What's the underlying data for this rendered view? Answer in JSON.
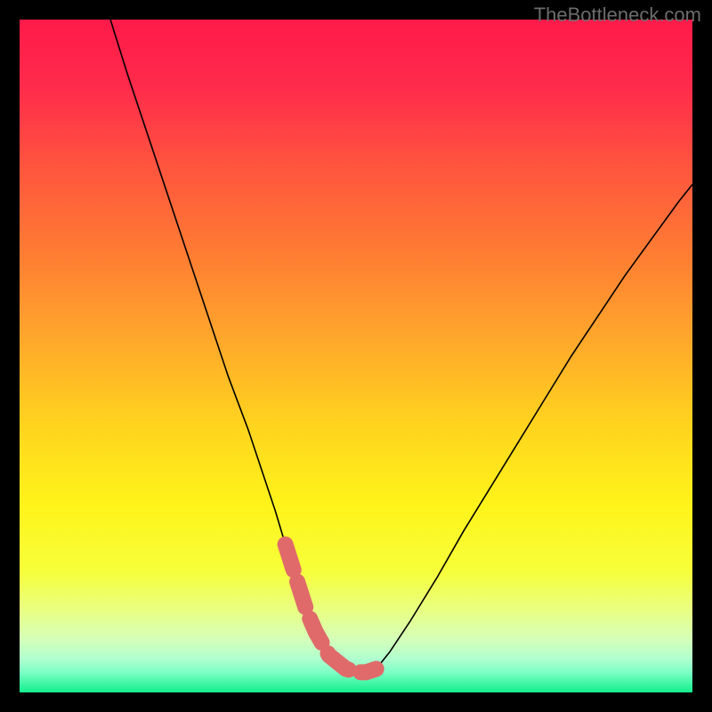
{
  "watermark": "TheBottleneck.com",
  "chart_data": {
    "type": "line",
    "title": "",
    "xlabel": "",
    "ylabel": "",
    "legend": [],
    "x_range": [
      0,
      100
    ],
    "y_range_percent": [
      0,
      100
    ],
    "background_gradient": {
      "stops": [
        {
          "pos": 0.0,
          "color": "#ff1a4a"
        },
        {
          "pos": 0.1,
          "color": "#ff2b4b"
        },
        {
          "pos": 0.22,
          "color": "#ff553e"
        },
        {
          "pos": 0.35,
          "color": "#ff7d33"
        },
        {
          "pos": 0.48,
          "color": "#ffa92b"
        },
        {
          "pos": 0.6,
          "color": "#ffd31e"
        },
        {
          "pos": 0.72,
          "color": "#fff31a"
        },
        {
          "pos": 0.82,
          "color": "#f6ff3a"
        },
        {
          "pos": 0.88,
          "color": "#e8ff85"
        },
        {
          "pos": 0.92,
          "color": "#d6ffb8"
        },
        {
          "pos": 0.95,
          "color": "#b0ffcf"
        },
        {
          "pos": 0.97,
          "color": "#7effc6"
        },
        {
          "pos": 0.985,
          "color": "#45f7a8"
        },
        {
          "pos": 1.0,
          "color": "#15ee8d"
        }
      ]
    },
    "series": [
      {
        "name": "bottleneck-curve",
        "stroke": "#000000",
        "x": [
          13.5,
          16,
          19,
          22,
          25,
          28,
          31,
          34,
          36,
          38,
          39.5,
          41,
          42.7,
          44,
          46,
          48.5,
          50.2,
          51.5,
          53,
          55,
          58,
          62,
          66,
          70,
          74,
          78,
          82,
          86,
          90,
          94,
          98,
          100
        ],
        "y_pct_from_top": [
          0,
          8,
          17,
          26,
          35,
          44,
          53,
          61,
          67,
          73,
          78,
          83,
          88,
          91,
          94.5,
          96.5,
          97,
          97,
          96.5,
          94,
          89.5,
          83,
          76,
          69.5,
          63,
          56.5,
          50,
          44,
          38,
          32.5,
          27,
          24.5
        ]
      }
    ],
    "annotations": [
      {
        "name": "valley-highlight",
        "type": "dashed-polyline",
        "color": "#e06a6a",
        "stroke_width": 18,
        "dash": "30 14",
        "points_x": [
          39.5,
          42.7,
          44,
          46,
          48.5,
          50.2,
          51.5,
          53
        ],
        "points_y_pct_from_top": [
          78,
          88,
          91,
          94.5,
          96.5,
          97,
          97,
          96.5
        ]
      }
    ]
  }
}
